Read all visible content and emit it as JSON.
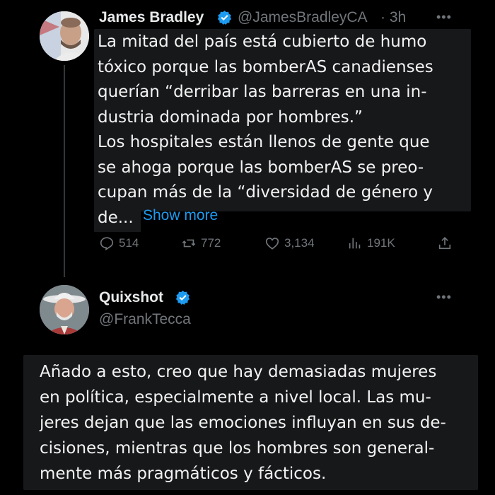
{
  "tweet": {
    "author_name": "James Bradley",
    "author_handle": "@JamesBradleyCA",
    "time": "· 3h",
    "more_icon": "•••",
    "text": "La mitad del país está cubierto de humo\ntóxico porque las bomberAS canadienses\nquerían “derribar las barreras en una in-\ndustria dominada por hombres.”\nLos hospitales están llenos de gente que\nse ahoga porque las bomberAS se preo-\ncupan más de la “diversidad de género y\nde...",
    "show_more": "Show more",
    "stats": {
      "replies": "514",
      "reposts": "772",
      "likes": "3,134",
      "views": "191K"
    }
  },
  "reply": {
    "author_name": "Quixshot",
    "author_handle": "@FrankTecca",
    "more_icon": "•••",
    "text": "Añado a esto, creo que hay demasiadas mujeres\nen política, especialmente a nivel local. Las mu-\njeres dejan que las emociones influyan en sus de-\ncisiones, mientras que los hombres son general-\nmente más pragmáticos y fácticos."
  },
  "colors": {
    "background": "#000000",
    "verified": "#1d9bf0",
    "link": "#1d9bf0",
    "muted": "#71767b",
    "text_highlight": "#17181a"
  },
  "icons": [
    "reply-icon",
    "repost-icon",
    "like-icon",
    "views-icon",
    "share-icon",
    "verified-badge-icon",
    "more-icon"
  ]
}
